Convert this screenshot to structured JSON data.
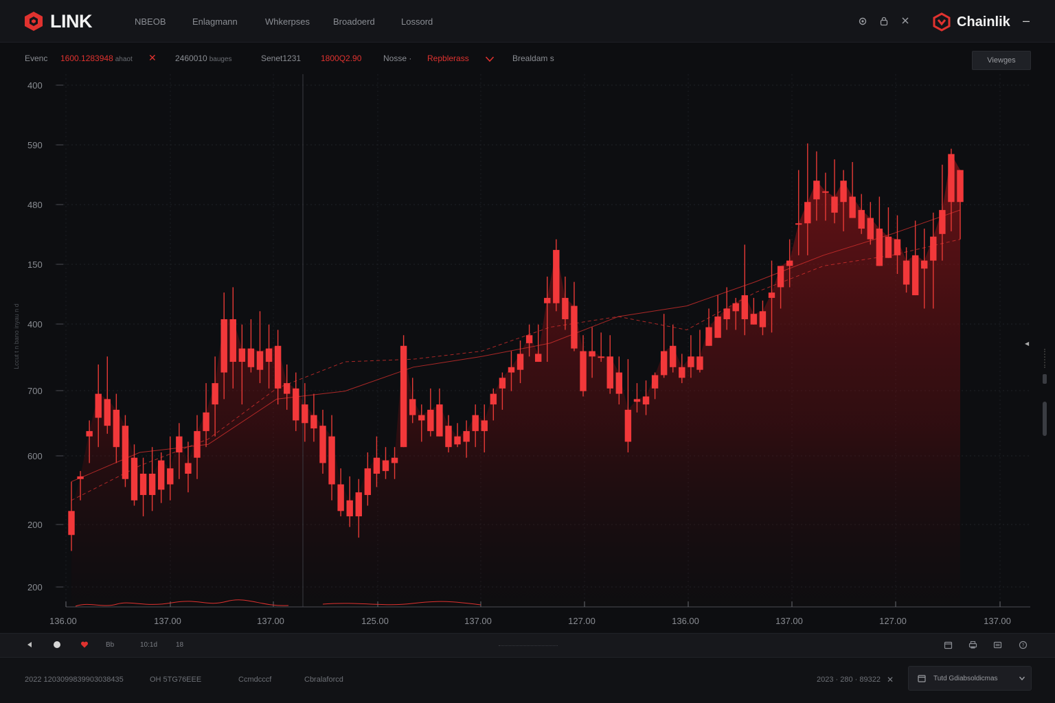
{
  "app": {
    "logo_text": "LINK",
    "brand_secondary": "Chainlik",
    "nav": [
      "NBEOB",
      "Enlagmann",
      "Whkerpses",
      "Broadoerd",
      "Lossord"
    ],
    "colors": {
      "accent": "#e0322f",
      "bg": "#0d0e11",
      "panel": "#141519",
      "text": "#8a8d93"
    }
  },
  "toolbar_icons": [
    "settings-icon",
    "lock-icon",
    "close-icon"
  ],
  "info_bar": {
    "label1": "Evenc",
    "value1": "1600.1283948",
    "value1_suffix": "ahaot",
    "value2": "2460010",
    "value2_suffix": "bauges",
    "label3": "Senet1231",
    "value3": "1800Q2.90",
    "label4": "Nosse ·",
    "dropdown": "Repblerass",
    "label5": "Brealdam s",
    "views_button": "Viewges"
  },
  "chart_data": {
    "type": "candlestick",
    "y_tick_labels": [
      "400",
      "590",
      "480",
      "150",
      "400",
      "700",
      "600",
      "200",
      "200"
    ],
    "x_tick_labels": [
      "136.00",
      "137.00",
      "137.00",
      "125.00",
      "137.00",
      "127.00",
      "136.00",
      "137.00",
      "127.00",
      "137.00"
    ],
    "ylim": [
      0,
      1000
    ],
    "grid": true,
    "series": [
      {
        "values": [
          {
            "o": 180,
            "h": 235,
            "l": 105,
            "c": 135
          },
          {
            "o": 240,
            "h": 255,
            "l": 200,
            "c": 245
          },
          {
            "o": 320,
            "h": 350,
            "l": 270,
            "c": 330
          },
          {
            "o": 400,
            "h": 455,
            "l": 300,
            "c": 355
          },
          {
            "o": 390,
            "h": 470,
            "l": 325,
            "c": 340
          },
          {
            "o": 370,
            "h": 400,
            "l": 270,
            "c": 300
          },
          {
            "o": 340,
            "h": 360,
            "l": 225,
            "c": 240
          },
          {
            "o": 280,
            "h": 305,
            "l": 190,
            "c": 200
          },
          {
            "o": 210,
            "h": 280,
            "l": 170,
            "c": 250
          },
          {
            "o": 250,
            "h": 300,
            "l": 180,
            "c": 210
          },
          {
            "o": 220,
            "h": 290,
            "l": 195,
            "c": 275
          },
          {
            "o": 260,
            "h": 320,
            "l": 200,
            "c": 230
          },
          {
            "o": 290,
            "h": 345,
            "l": 240,
            "c": 320
          },
          {
            "o": 270,
            "h": 310,
            "l": 215,
            "c": 250
          },
          {
            "o": 280,
            "h": 360,
            "l": 240,
            "c": 330
          },
          {
            "o": 330,
            "h": 420,
            "l": 300,
            "c": 365
          },
          {
            "o": 380,
            "h": 470,
            "l": 320,
            "c": 420
          },
          {
            "o": 440,
            "h": 590,
            "l": 390,
            "c": 540
          },
          {
            "o": 540,
            "h": 600,
            "l": 410,
            "c": 460
          },
          {
            "o": 460,
            "h": 530,
            "l": 380,
            "c": 485
          },
          {
            "o": 485,
            "h": 540,
            "l": 440,
            "c": 450
          },
          {
            "o": 480,
            "h": 555,
            "l": 420,
            "c": 445
          },
          {
            "o": 460,
            "h": 530,
            "l": 410,
            "c": 485
          },
          {
            "o": 490,
            "h": 520,
            "l": 380,
            "c": 410
          },
          {
            "o": 420,
            "h": 455,
            "l": 370,
            "c": 400
          },
          {
            "o": 410,
            "h": 440,
            "l": 330,
            "c": 350
          },
          {
            "o": 380,
            "h": 420,
            "l": 310,
            "c": 345
          },
          {
            "o": 360,
            "h": 400,
            "l": 310,
            "c": 335
          },
          {
            "o": 340,
            "h": 370,
            "l": 250,
            "c": 270
          },
          {
            "o": 320,
            "h": 360,
            "l": 200,
            "c": 230
          },
          {
            "o": 230,
            "h": 260,
            "l": 170,
            "c": 180
          },
          {
            "o": 200,
            "h": 245,
            "l": 150,
            "c": 170
          },
          {
            "o": 170,
            "h": 240,
            "l": 130,
            "c": 215
          },
          {
            "o": 210,
            "h": 290,
            "l": 190,
            "c": 260
          },
          {
            "o": 250,
            "h": 320,
            "l": 225,
            "c": 280
          },
          {
            "o": 275,
            "h": 300,
            "l": 240,
            "c": 255
          },
          {
            "o": 270,
            "h": 300,
            "l": 240,
            "c": 280
          },
          {
            "o": 300,
            "h": 510,
            "l": 300,
            "c": 490
          },
          {
            "o": 390,
            "h": 430,
            "l": 345,
            "c": 360
          },
          {
            "o": 360,
            "h": 380,
            "l": 310,
            "c": 350
          },
          {
            "o": 370,
            "h": 410,
            "l": 320,
            "c": 330
          },
          {
            "o": 380,
            "h": 410,
            "l": 320,
            "c": 320
          },
          {
            "o": 340,
            "h": 360,
            "l": 290,
            "c": 300
          },
          {
            "o": 320,
            "h": 345,
            "l": 300,
            "c": 305
          },
          {
            "o": 310,
            "h": 350,
            "l": 280,
            "c": 330
          },
          {
            "o": 360,
            "h": 380,
            "l": 300,
            "c": 330
          },
          {
            "o": 330,
            "h": 380,
            "l": 290,
            "c": 350
          },
          {
            "o": 380,
            "h": 410,
            "l": 350,
            "c": 400
          },
          {
            "o": 410,
            "h": 440,
            "l": 370,
            "c": 430
          },
          {
            "o": 440,
            "h": 480,
            "l": 405,
            "c": 450
          },
          {
            "o": 445,
            "h": 500,
            "l": 420,
            "c": 475
          },
          {
            "o": 495,
            "h": 530,
            "l": 470,
            "c": 510
          },
          {
            "o": 460,
            "h": 530,
            "l": 470,
            "c": 475
          },
          {
            "o": 580,
            "h": 620,
            "l": 460,
            "c": 570
          },
          {
            "o": 570,
            "h": 690,
            "l": 555,
            "c": 670
          },
          {
            "o": 580,
            "h": 620,
            "l": 520,
            "c": 540
          },
          {
            "o": 565,
            "h": 610,
            "l": 480,
            "c": 485
          },
          {
            "o": 480,
            "h": 510,
            "l": 395,
            "c": 405
          },
          {
            "o": 480,
            "h": 525,
            "l": 430,
            "c": 470
          },
          {
            "o": 470,
            "h": 515,
            "l": 460,
            "c": 470
          },
          {
            "o": 470,
            "h": 510,
            "l": 400,
            "c": 410
          },
          {
            "o": 440,
            "h": 470,
            "l": 380,
            "c": 400
          },
          {
            "o": 370,
            "h": 465,
            "l": 290,
            "c": 310
          },
          {
            "o": 385,
            "h": 420,
            "l": 365,
            "c": 390
          },
          {
            "o": 395,
            "h": 425,
            "l": 360,
            "c": 380
          },
          {
            "o": 410,
            "h": 440,
            "l": 390,
            "c": 435
          },
          {
            "o": 435,
            "h": 550,
            "l": 430,
            "c": 480
          },
          {
            "o": 490,
            "h": 530,
            "l": 440,
            "c": 450
          },
          {
            "o": 450,
            "h": 475,
            "l": 420,
            "c": 430
          },
          {
            "o": 450,
            "h": 510,
            "l": 430,
            "c": 470
          },
          {
            "o": 470,
            "h": 520,
            "l": 440,
            "c": 445
          },
          {
            "o": 525,
            "h": 560,
            "l": 500,
            "c": 490
          },
          {
            "o": 545,
            "h": 585,
            "l": 515,
            "c": 505
          },
          {
            "o": 540,
            "h": 600,
            "l": 520,
            "c": 560
          },
          {
            "o": 555,
            "h": 580,
            "l": 520,
            "c": 570
          },
          {
            "o": 585,
            "h": 680,
            "l": 510,
            "c": 540
          },
          {
            "o": 550,
            "h": 580,
            "l": 530,
            "c": 530
          },
          {
            "o": 525,
            "h": 575,
            "l": 510,
            "c": 555
          },
          {
            "o": 580,
            "h": 650,
            "l": 515,
            "c": 590
          },
          {
            "o": 600,
            "h": 630,
            "l": 560,
            "c": 640
          },
          {
            "o": 640,
            "h": 690,
            "l": 600,
            "c": 650
          },
          {
            "o": 720,
            "h": 820,
            "l": 660,
            "c": 720
          },
          {
            "o": 720,
            "h": 870,
            "l": 660,
            "c": 760
          },
          {
            "o": 765,
            "h": 855,
            "l": 725,
            "c": 800
          },
          {
            "o": 780,
            "h": 815,
            "l": 725,
            "c": 780
          },
          {
            "o": 770,
            "h": 840,
            "l": 720,
            "c": 740
          },
          {
            "o": 800,
            "h": 820,
            "l": 705,
            "c": 760
          },
          {
            "o": 770,
            "h": 835,
            "l": 740,
            "c": 730
          },
          {
            "o": 745,
            "h": 775,
            "l": 700,
            "c": 710
          },
          {
            "o": 730,
            "h": 760,
            "l": 680,
            "c": 690
          },
          {
            "o": 710,
            "h": 770,
            "l": 665,
            "c": 640
          },
          {
            "o": 695,
            "h": 750,
            "l": 675,
            "c": 655
          },
          {
            "o": 660,
            "h": 735,
            "l": 625,
            "c": 690
          },
          {
            "o": 650,
            "h": 675,
            "l": 590,
            "c": 605
          },
          {
            "o": 660,
            "h": 725,
            "l": 600,
            "c": 585
          },
          {
            "o": 635,
            "h": 710,
            "l": 560,
            "c": 650
          },
          {
            "o": 650,
            "h": 740,
            "l": 560,
            "c": 695
          },
          {
            "o": 700,
            "h": 830,
            "l": 650,
            "c": 745
          },
          {
            "o": 760,
            "h": 860,
            "l": 705,
            "c": 850
          },
          {
            "o": 820,
            "h": 775,
            "l": 690,
            "c": 760
          }
        ]
      }
    ],
    "overlays": [
      {
        "style": "solid",
        "values": [
          235,
          290,
          305,
          390,
          405,
          450,
          470,
          495,
          545,
          565,
          610,
          660,
          700,
          745
        ]
      },
      {
        "style": "dashed",
        "values": [
          200,
          265,
          315,
          410,
          460,
          465,
          480,
          525,
          545,
          520,
          590,
          640,
          660,
          690
        ]
      }
    ]
  },
  "playbar": {
    "items": [
      "Bb",
      "10:1d",
      "18"
    ],
    "right_icons": [
      "calendar-icon",
      "printer-icon",
      "grid-icon",
      "info-icon"
    ]
  },
  "status_bar": {
    "left": "2022 1203099839903038435",
    "left2": "OH 5TG76EEE",
    "mid1": "Ccmdcccf",
    "mid2": "Cbralaforcd",
    "right_date": "2023 · 280 · 89322",
    "select_value": "Tutd Gdiabsoldicmas"
  }
}
